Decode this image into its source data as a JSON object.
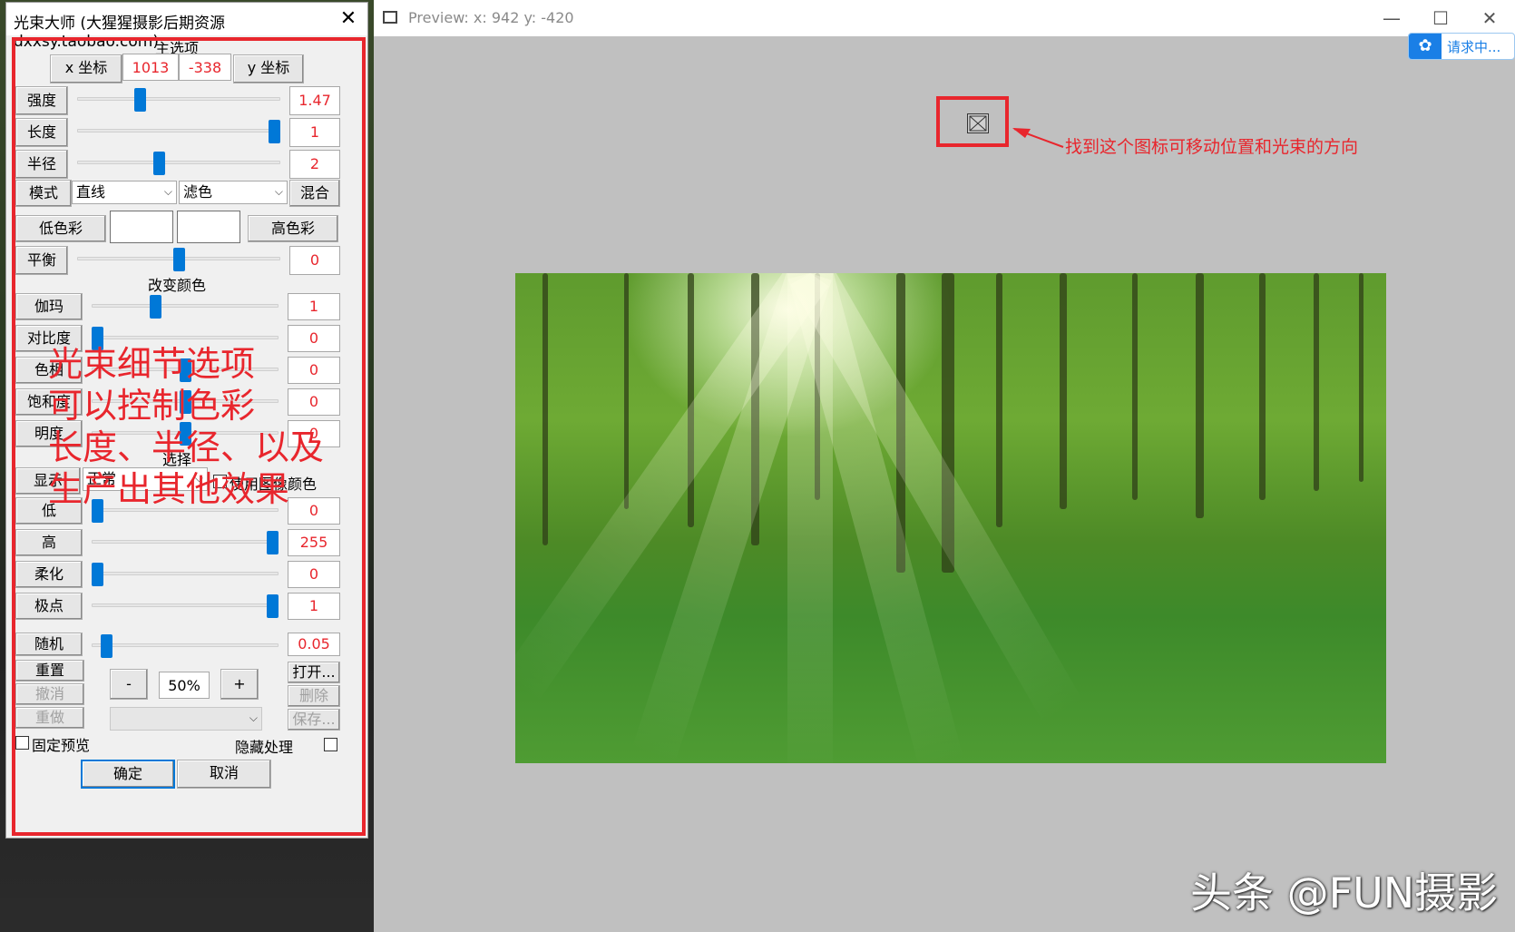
{
  "dialog": {
    "title": "光束大师 (大猩猩摄影后期资源 dxxsy.taobao.com)",
    "close_glyph": "✕",
    "main_section": "主选项",
    "x_label": "x 坐标",
    "x_value": "1013",
    "y_value": "-338",
    "y_label": "y 坐标",
    "sliders_main": [
      {
        "label": "强度",
        "value": "1.47",
        "level": 0.3
      },
      {
        "label": "长度",
        "value": "1",
        "level": 1.0
      },
      {
        "label": "半径",
        "value": "2",
        "level": 0.4
      }
    ],
    "mode_label": "模式",
    "mode_line": "直线",
    "mode_blend": "滤色",
    "blend_button": "混合",
    "low_color": "低色彩",
    "high_color": "高色彩",
    "balance": {
      "label": "平衡",
      "value": "0",
      "level": 0.5
    },
    "color_section": "改变颜色",
    "sliders_color": [
      {
        "label": "伽玛",
        "value": "1",
        "level": 0.33
      },
      {
        "label": "对比度",
        "value": "0",
        "level": 0.0
      },
      {
        "label": "色相",
        "value": "0",
        "level": 0.5
      },
      {
        "label": "饱和度",
        "value": "0",
        "level": 0.5
      },
      {
        "label": "明度",
        "value": "0",
        "level": 0.5
      }
    ],
    "select_section": "选择",
    "display_label": "显示",
    "display_mode": "正常",
    "use_image_color": "使用图像颜色",
    "sliders_select": [
      {
        "label": "低",
        "value": "0",
        "level": 0.0
      },
      {
        "label": "高",
        "value": "255",
        "level": 1.0
      },
      {
        "label": "柔化",
        "value": "0",
        "level": 0.0
      },
      {
        "label": "极点",
        "value": "1",
        "level": 1.0
      }
    ],
    "random": {
      "label": "随机",
      "value": "0.05",
      "level": 0.05
    },
    "reset": "重置",
    "undo": "撤消",
    "redo": "重做",
    "minus": "-",
    "zoom": "50%",
    "plus": "+",
    "open": "打开...",
    "delete": "删除",
    "save": "保存...",
    "fixed_preview": "固定预览",
    "hide_processing": "隐藏处理",
    "ok": "确定",
    "cancel": "取消"
  },
  "overlay_lines": [
    "光束细节选项",
    "可以控制色彩",
    "长度、半径、以及",
    "生产出其他效果"
  ],
  "preview": {
    "title": "Preview:  x: 942 y: -420",
    "cloud_label": "请求中...",
    "annotation": "找到这个图标可移动位置和光束的方向"
  },
  "watermark": "头条 @FUN摄影",
  "colors": {
    "accent_red": "#e8262d",
    "slider_blue": "#0078d7"
  }
}
